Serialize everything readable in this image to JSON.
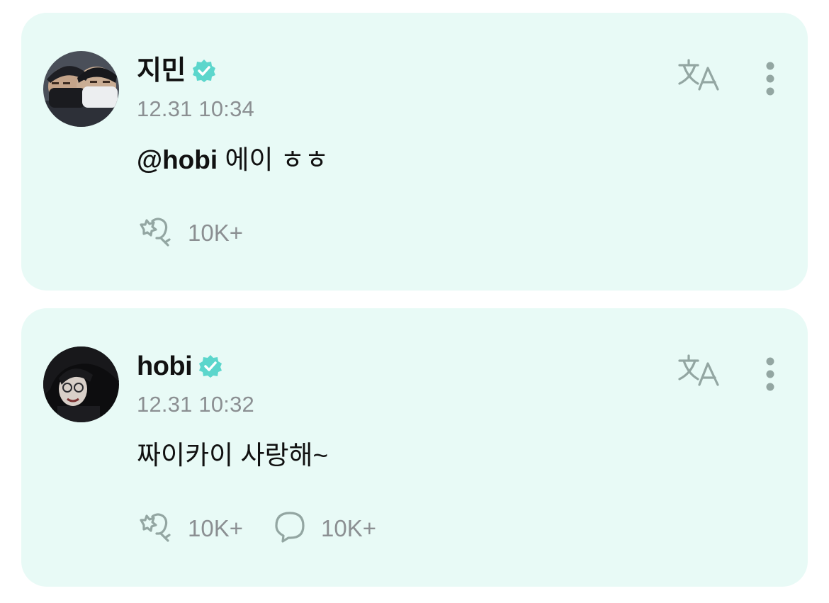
{
  "posts": [
    {
      "author": "지민",
      "verified": true,
      "timestamp": "12.31 10:34",
      "mention": "@hobi",
      "text": " 에이 ㅎㅎ",
      "actions": {
        "like_icon": "cheer-icon",
        "like_count": "10K+"
      },
      "translate_icon": "translate-icon",
      "more_icon": "more-vertical-icon"
    },
    {
      "author": "hobi",
      "verified": true,
      "timestamp": "12.31 10:32",
      "text": "짜이카이 사랑해~",
      "actions": {
        "like_icon": "cheer-icon",
        "like_count": "10K+",
        "comment_icon": "comment-icon",
        "comment_count": "10K+"
      },
      "translate_icon": "translate-icon",
      "more_icon": "more-vertical-icon"
    }
  ],
  "colors": {
    "card_background": "#e8faf6",
    "verified_badge": "#5cd6cc",
    "muted_text": "#8b8f92",
    "icon": "#93a6a2"
  }
}
